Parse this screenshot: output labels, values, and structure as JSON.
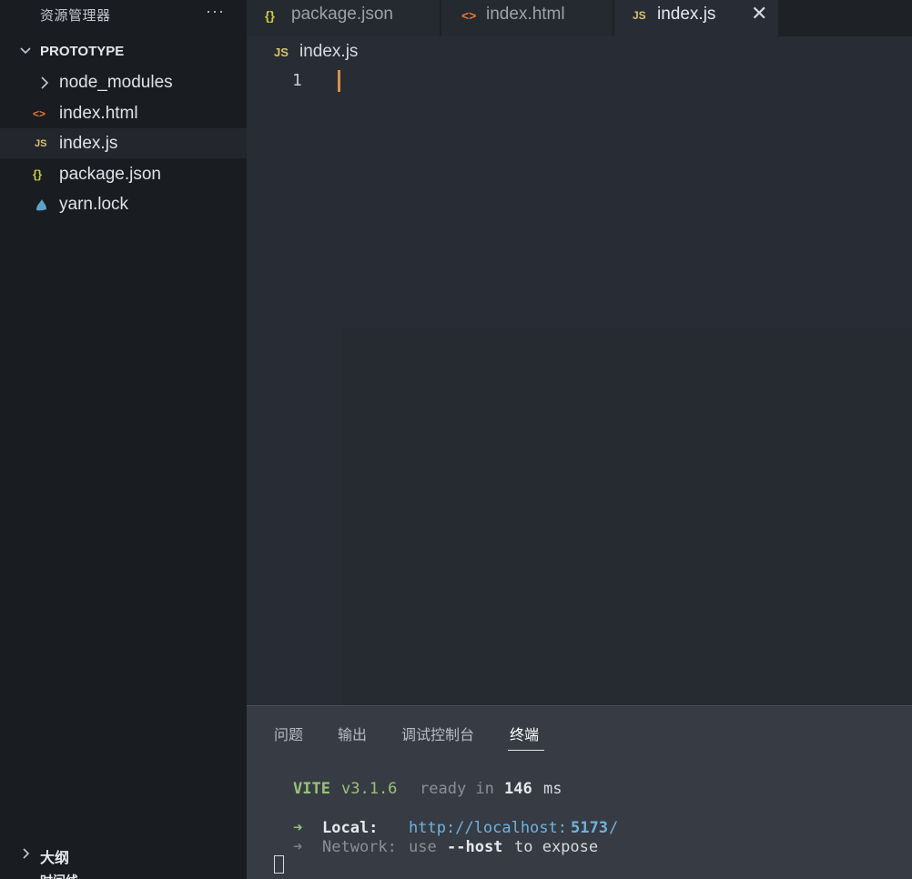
{
  "sidebar": {
    "title": "资源管理器",
    "more_label": "···",
    "project": "PROTOTYPE",
    "items": [
      {
        "label": "node_modules",
        "icon": "chevron-right-icon",
        "icon_text": ""
      },
      {
        "label": "index.html",
        "icon": "html-file-icon",
        "icon_text": "<>"
      },
      {
        "label": "index.js",
        "icon": "js-file-icon",
        "icon_text": "JS"
      },
      {
        "label": "package.json",
        "icon": "json-file-icon",
        "icon_text": "{}"
      },
      {
        "label": "yarn.lock",
        "icon": "yarn-file-icon",
        "icon_text": ""
      }
    ],
    "outline": "大纲",
    "timeline": "时间线"
  },
  "tabs": [
    {
      "label": "package.json",
      "icon_text": "{}"
    },
    {
      "label": "index.html",
      "icon_text": "<>"
    },
    {
      "label": "index.js",
      "icon_text": "JS",
      "close": "✕"
    }
  ],
  "editor": {
    "breadcrumb_icon": "JS",
    "breadcrumb": "index.js",
    "line_number": "1"
  },
  "panel": {
    "tabs": [
      "问题",
      "输出",
      "调试控制台",
      "终端"
    ],
    "terminal": {
      "vite": "VITE",
      "version": "v3.1.6",
      "ready": "ready in",
      "ms_value": "146",
      "ms": "ms",
      "arrow": "➜",
      "local_label": "Local:",
      "local_url_prefix": "http://localhost:",
      "local_port": "5173",
      "local_url_suffix": "/",
      "network_label": "Network:",
      "network_use": "use",
      "network_flag": "--host",
      "network_rest": "to expose"
    }
  },
  "colors": {
    "html_icon": "#e37933",
    "js_icon": "#d9c46c",
    "json_icon": "#cbcb41",
    "vite_green": "#98c379",
    "url_blue": "#6fb3e0"
  }
}
